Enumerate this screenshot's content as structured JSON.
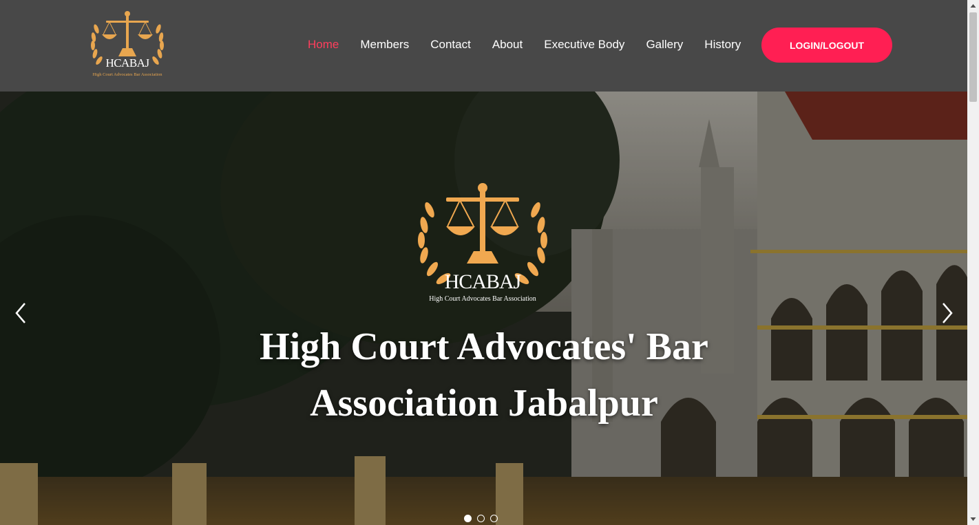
{
  "brand": {
    "abbr": "HCABAJ",
    "full_name": "High Court Advocates Bar Association",
    "accent_color": "#e8a64f"
  },
  "nav": {
    "items": [
      {
        "label": "Home",
        "active": true
      },
      {
        "label": "Members"
      },
      {
        "label": "Contact"
      },
      {
        "label": "About"
      },
      {
        "label": "Executive Body"
      },
      {
        "label": "Gallery"
      },
      {
        "label": "History"
      }
    ],
    "active_color": "#ff3e5d",
    "login_label": "LOGIN/LOGOUT",
    "login_color": "#ff1f53"
  },
  "hero": {
    "logo_abbr": "HCABAJ",
    "logo_sub": "High Court Advocates Bar Association",
    "title_line1": "High Court Advocates' Bar",
    "title_line2": "Association Jabalpur",
    "prev_icon": "chevron-left-icon",
    "next_icon": "chevron-right-icon",
    "slides": 3,
    "active_slide": 1
  }
}
